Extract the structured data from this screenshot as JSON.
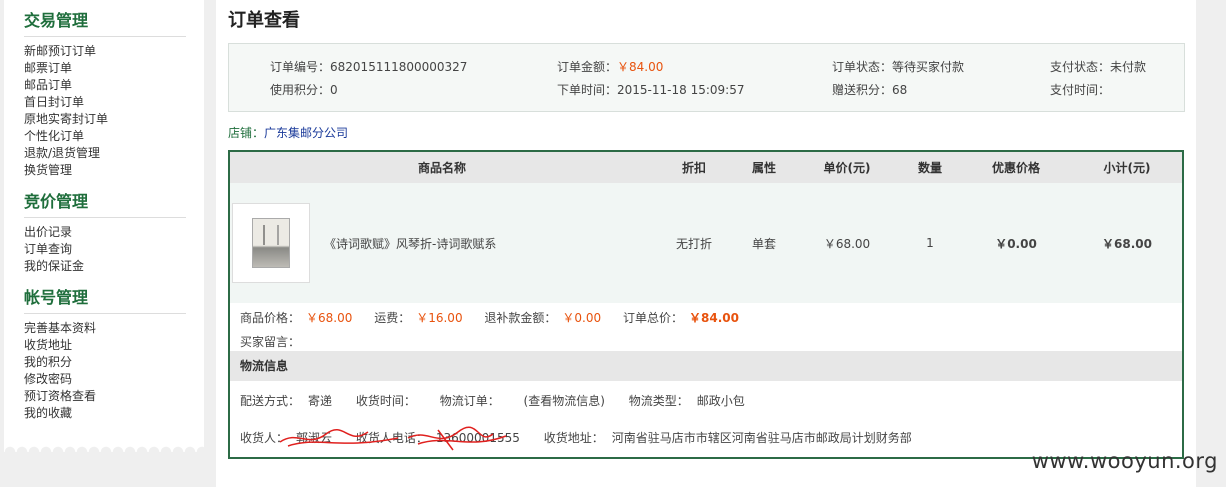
{
  "sidebar": {
    "groups": [
      {
        "title": "交易管理",
        "items": [
          "新邮预订订单",
          "邮票订单",
          "邮品订单",
          "首日封订单",
          "原地实寄封订单",
          "个性化订单",
          "退款/退货管理",
          "换货管理"
        ]
      },
      {
        "title": "竞价管理",
        "items": [
          "出价记录",
          "订单查询",
          "我的保证金"
        ]
      },
      {
        "title": "帐号管理",
        "items": [
          "完善基本资料",
          "收货地址",
          "我的积分",
          "修改密码",
          "预订资格查看",
          "我的收藏"
        ]
      }
    ]
  },
  "page": {
    "title": "订单查看"
  },
  "summary": {
    "order_no_label": "订单编号：",
    "order_no": "682015111800000327",
    "amount_label": "订单金额：",
    "amount": "￥84.00",
    "status_label": "订单状态：",
    "status": "等待买家付款",
    "pay_status_label": "支付状态：",
    "pay_status": "未付款",
    "points_used_label": "使用积分：",
    "points_used": "0",
    "order_time_label": "下单时间：",
    "order_time": "2015-11-18 15:09:57",
    "points_gift_label": "赠送积分：",
    "points_gift": "68",
    "pay_time_label": "支付时间：",
    "pay_time": ""
  },
  "shop": {
    "label": "店铺：",
    "name": "广东集邮分公司"
  },
  "goods_table": {
    "headers": [
      "商品名称",
      "折扣",
      "属性",
      "单价(元)",
      "数量",
      "优惠价格",
      "小计(元)"
    ],
    "rows": [
      {
        "name": "《诗词歌赋》风琴折-诗词歌赋系",
        "discount": "无打折",
        "attr": "单套",
        "unit_price": "￥68.00",
        "qty": "1",
        "promo_price": "￥0.00",
        "subtotal": "￥68.00"
      }
    ]
  },
  "totals": {
    "goods_price_label": "商品价格：",
    "goods_price": "￥68.00",
    "shipping_label": "运费：",
    "shipping": "￥16.00",
    "refund_label": "退补款金额：",
    "refund": "￥0.00",
    "total_label": "订单总价：",
    "total": "￥84.00",
    "message_label": "买家留言："
  },
  "logistics": {
    "title": "物流信息",
    "method_label": "配送方式：",
    "method": "寄递",
    "receive_time_label": "收货时间：",
    "tracking_label": "物流订单：",
    "tracking_link": "(查看物流信息)",
    "type_label": "物流类型：",
    "type": "邮政小包",
    "receiver_label": "收货人：",
    "receiver": "郭淑云",
    "phone_label": "收货人电话：",
    "phone": "13600001555",
    "address_label": "收货地址：",
    "address": "河南省驻马店市市辖区河南省驻马店市邮政局计划财务部"
  },
  "watermark": "www.wooyun.org"
}
